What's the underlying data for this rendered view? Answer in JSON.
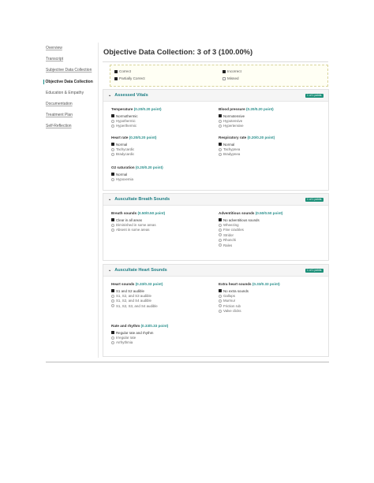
{
  "sidebar": {
    "items": [
      {
        "label": "Overview",
        "style": "link"
      },
      {
        "label": "Transcript",
        "style": "link"
      },
      {
        "label": "Subjective Data Collection",
        "style": "link"
      },
      {
        "label": "Objective Data Collection",
        "style": "active"
      },
      {
        "label": "Education & Empathy",
        "style": "plain"
      },
      {
        "label": "Documentation",
        "style": "link"
      },
      {
        "label": "Treatment Plan",
        "style": "link"
      },
      {
        "label": "Self-Reflection",
        "style": "link"
      }
    ]
  },
  "header": {
    "title": "Objective Data Collection: 3 of 3 (100.00%)"
  },
  "legend": {
    "correct": "Correct",
    "partially_correct": "Partially Correct",
    "incorrect": "Incorrect",
    "missed": "Missed"
  },
  "sections": [
    {
      "title": "Assessed Vitals",
      "badge": "1 of 1 points",
      "groups": [
        {
          "title": "Temperature",
          "points": "(0.20/0.20 point)",
          "options": [
            {
              "label": "Normothermic",
              "selected": true
            },
            {
              "label": "Hypothermic",
              "selected": false
            },
            {
              "label": "Hyperthermic",
              "selected": false
            }
          ]
        },
        {
          "title": "Blood pressure",
          "points": "(0.20/0.20 point)",
          "options": [
            {
              "label": "Normotensive",
              "selected": true
            },
            {
              "label": "Hypotensive",
              "selected": false
            },
            {
              "label": "Hypertensive",
              "selected": false
            }
          ]
        },
        {
          "title": "Heart rate",
          "points": "(0.20/0.20 point)",
          "options": [
            {
              "label": "Normal",
              "selected": true
            },
            {
              "label": "Tachycardic",
              "selected": false
            },
            {
              "label": "Bradycardic",
              "selected": false
            }
          ]
        },
        {
          "title": "Respiratory rate",
          "points": "(0.20/0.20 point)",
          "options": [
            {
              "label": "Normal",
              "selected": true
            },
            {
              "label": "Tachypnea",
              "selected": false
            },
            {
              "label": "Bradypnea",
              "selected": false
            }
          ]
        },
        {
          "title": "O2 saturation",
          "points": "(0.20/0.20 point)",
          "options": [
            {
              "label": "Normal",
              "selected": true
            },
            {
              "label": "Hypoxemia",
              "selected": false
            }
          ]
        }
      ]
    },
    {
      "title": "Auscultate Breath Sounds",
      "badge": "1 of 1 points",
      "groups": [
        {
          "title": "Breath sounds",
          "points": "(0.50/0.50 point)",
          "options": [
            {
              "label": "Clear in all areas",
              "selected": true
            },
            {
              "label": "Diminished in some areas",
              "selected": false
            },
            {
              "label": "Absent in some areas",
              "selected": false
            }
          ]
        },
        {
          "title": "Adventitious sounds",
          "points": "(0.50/0.50 point)",
          "options": [
            {
              "label": "No adventitious sounds",
              "selected": true
            },
            {
              "label": "Wheezing",
              "selected": false
            },
            {
              "label": "Fine crackles",
              "selected": false
            },
            {
              "label": "Stridor",
              "selected": false
            },
            {
              "label": "Rhonchi",
              "selected": false
            },
            {
              "label": "Rales",
              "selected": false
            }
          ]
        }
      ]
    },
    {
      "title": "Auscultate Heart Sounds",
      "badge": "1 of 1 points",
      "groups": [
        {
          "title": "Heart sounds",
          "points": "(0.33/0.33 point)",
          "options": [
            {
              "label": "S1 and S2 audible",
              "selected": true
            },
            {
              "label": "S1, S2, and S3 audible",
              "selected": false
            },
            {
              "label": "S1, S2, and S4 audible",
              "selected": false
            },
            {
              "label": "S1, S2, S3, and S4 audible",
              "selected": false
            }
          ]
        },
        {
          "title": "Extra heart sounds",
          "points": "(0.33/0.33 point)",
          "options": [
            {
              "label": "No extra sounds",
              "selected": true
            },
            {
              "label": "Gallops",
              "selected": false
            },
            {
              "label": "Murmur",
              "selected": false
            },
            {
              "label": "Friction rub",
              "selected": false
            },
            {
              "label": "Valve clicks",
              "selected": false
            }
          ]
        },
        {
          "title": "Rate and rhythm",
          "points": "(0.33/0.33 point)",
          "options": [
            {
              "label": "Regular rate and rhythm",
              "selected": true
            },
            {
              "label": "Irregular rate",
              "selected": false
            },
            {
              "label": "Arrhythmia",
              "selected": false
            }
          ]
        }
      ]
    }
  ],
  "colors": {
    "accent": "#1a8f8a",
    "badge": "#1b8f78",
    "selected_check": "#222222"
  }
}
